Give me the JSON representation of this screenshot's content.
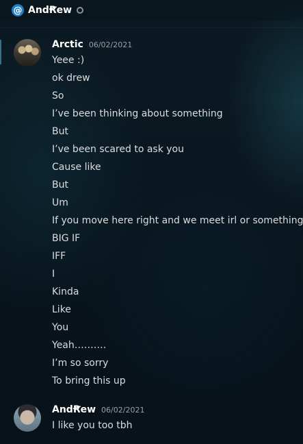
{
  "header": {
    "at_symbol": "@",
    "title": "AndꞦew",
    "status": "offline"
  },
  "colors": {
    "mention_blue": "#1e7fc4",
    "text": "#dcddde",
    "timestamp": "#9aa0a6"
  },
  "messages": [
    {
      "author": "Arctic",
      "timestamp": "06/02/2021",
      "lines": [
        "Yeee :)",
        "ok drew",
        "So",
        "I’ve been thinking about something",
        "But",
        "I’ve been scared to ask you",
        "Cause like",
        "But",
        "Um",
        "If you move here right and we meet irl or something",
        "BIG IF",
        "IFF",
        "I",
        "Kinda",
        "Like",
        "You",
        "Yeah……….",
        "I’m so sorry",
        "To bring this up"
      ]
    },
    {
      "author": "AndꞦew",
      "timestamp": "06/02/2021",
      "lines": [
        "I like you too tbh"
      ]
    }
  ]
}
